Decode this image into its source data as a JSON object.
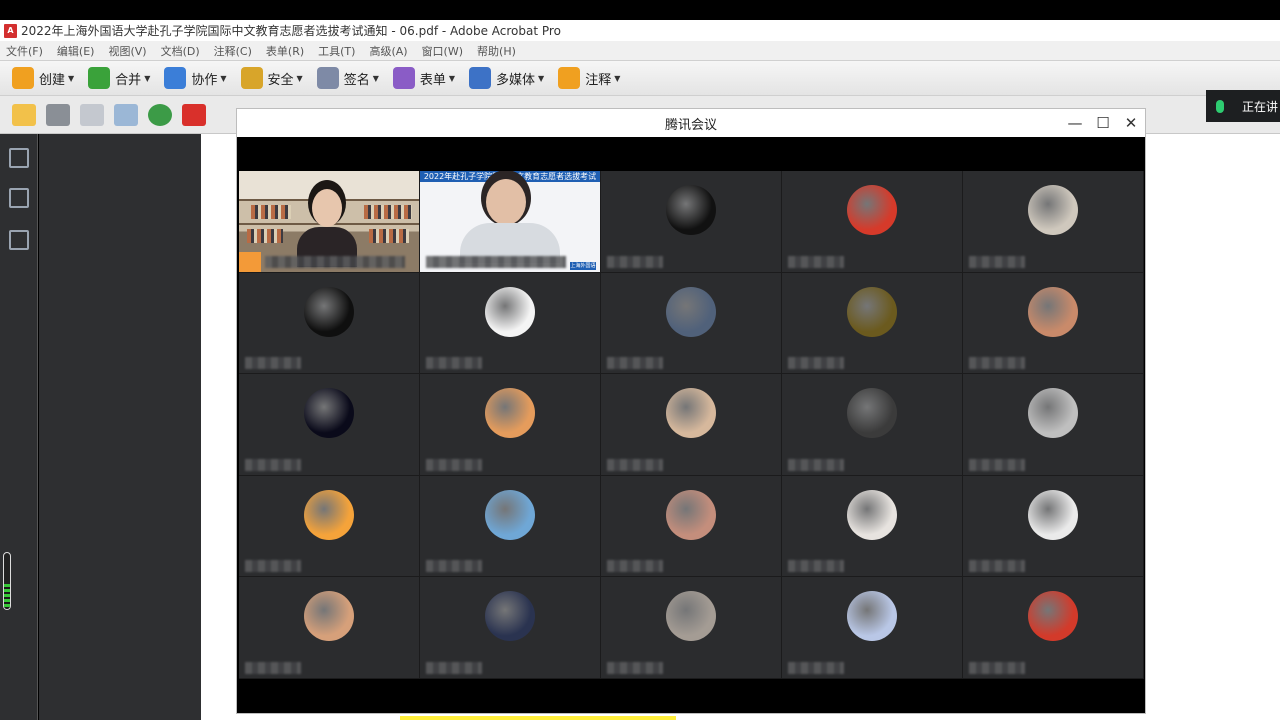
{
  "acrobat": {
    "title": "2022年上海外国语大学赴孔子学院国际中文教育志愿者选拔考试通知 - 06.pdf - Adobe Acrobat Pro",
    "menu": [
      "文件(F)",
      "编辑(E)",
      "视图(V)",
      "文档(D)",
      "注释(C)",
      "表单(R)",
      "工具(T)",
      "高级(A)",
      "窗口(W)",
      "帮助(H)"
    ],
    "toolbar": [
      {
        "label": "创建",
        "icon": "create-icon",
        "color": "#f0a020"
      },
      {
        "label": "合并",
        "icon": "combine-icon",
        "color": "#3aa23a"
      },
      {
        "label": "协作",
        "icon": "collaborate-icon",
        "color": "#3b7ed8"
      },
      {
        "label": "安全",
        "icon": "lock-icon",
        "color": "#d8a52a"
      },
      {
        "label": "签名",
        "icon": "pen-icon",
        "color": "#7e8aa6"
      },
      {
        "label": "表单",
        "icon": "form-icon",
        "color": "#8a5cc6"
      },
      {
        "label": "多媒体",
        "icon": "multimedia-icon",
        "color": "#3d72c6"
      },
      {
        "label": "注释",
        "icon": "comment-icon",
        "color": "#f0a020"
      }
    ]
  },
  "speaking": {
    "label": "正在讲"
  },
  "meeting": {
    "title": "腾讯会议",
    "minimize": "—",
    "maximize": "☐",
    "close": "✕",
    "share_banner": "2022年赴孔子学院国际中文教育志愿者选拔考试",
    "share_tag": "上海外国语",
    "avatar_colors": [
      "#111111",
      "#d63a2a",
      "#cfc8bd",
      "#0f0f0f",
      "#f4f4f4",
      "#50617a",
      "#6b5a1e",
      "#c98a6a",
      "#0a0a1a",
      "#e59c5c",
      "#d6b89c",
      "#3b3b3b",
      "#bfbfbf",
      "#f5a33a",
      "#6fa7d6",
      "#c48e7c",
      "#e7e3df",
      "#eaeaea",
      "#d6a07a",
      "#2a3350",
      "#a49c94",
      "#b9c7e6",
      "#d33a2a"
    ]
  }
}
